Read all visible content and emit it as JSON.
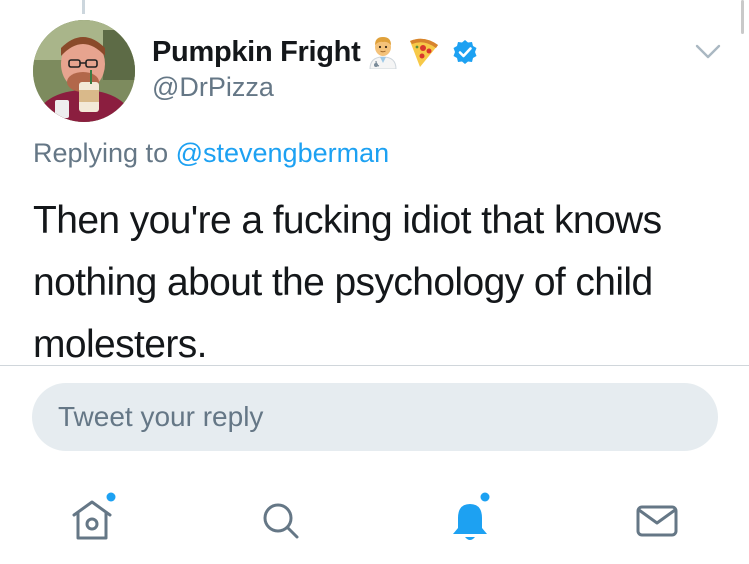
{
  "tweet": {
    "author": {
      "display_name": "Pumpkin Fright",
      "handle": "@DrPizza",
      "emojis": [
        "man-health-worker-emoji",
        "pizza-emoji"
      ],
      "verified": true
    },
    "replying_prefix": "Replying to ",
    "replying_to": "@stevengberman",
    "text": "Then you're a fucking idiot that knows nothing about the psychology of child molesters."
  },
  "reply_composer": {
    "placeholder": "Tweet your reply"
  },
  "tabbar": {
    "items": [
      {
        "name": "home",
        "icon": "home-icon",
        "unread_dot": true,
        "active": false
      },
      {
        "name": "search",
        "icon": "search-icon",
        "unread_dot": false,
        "active": false
      },
      {
        "name": "notifications",
        "icon": "bell-icon",
        "unread_dot": true,
        "active": true
      },
      {
        "name": "messages",
        "icon": "envelope-icon",
        "unread_dot": false,
        "active": false
      }
    ]
  },
  "colors": {
    "accent": "#1da1f2",
    "text": "#14171a",
    "secondary_text": "#657786",
    "input_bg": "#e6ecf0"
  }
}
